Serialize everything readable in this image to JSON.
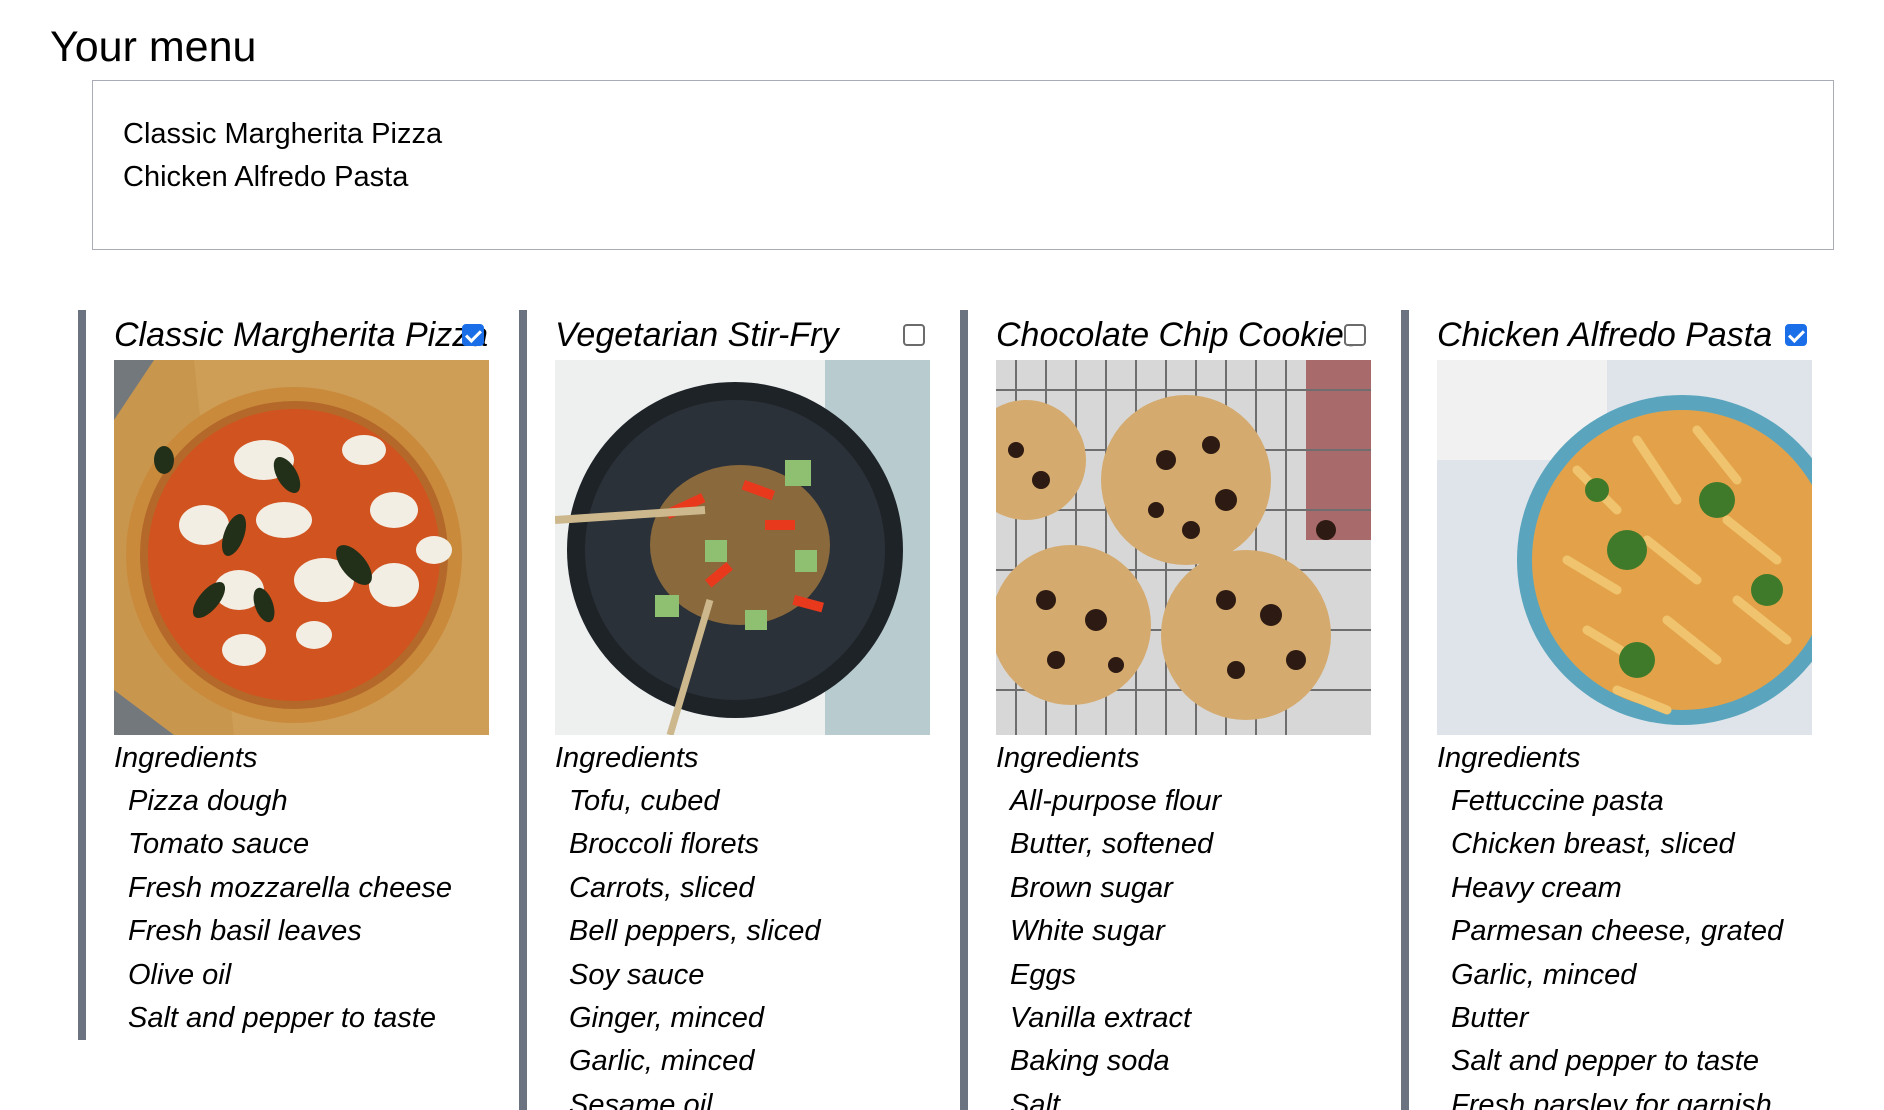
{
  "menu": {
    "title": "Your menu",
    "selected": [
      "Classic Margherita Pizza",
      "Chicken Alfredo Pasta"
    ]
  },
  "recipes": [
    {
      "title": "Classic Margherita Pizza",
      "checked": true,
      "image_icon": "pizza-photo",
      "ingredients_label": "Ingredients",
      "ingredients": [
        "Pizza dough",
        "Tomato sauce",
        "Fresh mozzarella cheese",
        "Fresh basil leaves",
        "Olive oil",
        "Salt and pepper to taste"
      ]
    },
    {
      "title": "Vegetarian Stir-Fry",
      "checked": false,
      "image_icon": "stir-fry-photo",
      "ingredients_label": "Ingredients",
      "ingredients": [
        "Tofu, cubed",
        "Broccoli florets",
        "Carrots, sliced",
        "Bell peppers, sliced",
        "Soy sauce",
        "Ginger, minced",
        "Garlic, minced",
        "Sesame oil"
      ]
    },
    {
      "title": "Chocolate Chip Cookies",
      "checked": false,
      "image_icon": "cookies-photo",
      "ingredients_label": "Ingredients",
      "ingredients": [
        "All-purpose flour",
        "Butter, softened",
        "Brown sugar",
        "White sugar",
        "Eggs",
        "Vanilla extract",
        "Baking soda",
        "Salt"
      ]
    },
    {
      "title": "Chicken Alfredo Pasta",
      "checked": true,
      "image_icon": "pasta-photo",
      "ingredients_label": "Ingredients",
      "ingredients": [
        "Fettuccine pasta",
        "Chicken breast, sliced",
        "Heavy cream",
        "Parmesan cheese, grated",
        "Garlic, minced",
        "Butter",
        "Salt and pepper to taste",
        "Fresh parsley for garnish"
      ]
    }
  ],
  "colors": {
    "card_border": "#6b7280",
    "checkbox_checked": "#1a6fe8",
    "menu_border": "#a9acb6"
  }
}
